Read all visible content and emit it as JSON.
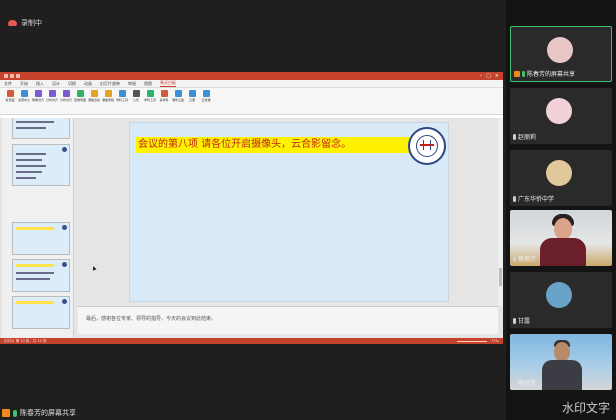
{
  "recording": {
    "label": "录制中"
  },
  "screen_share": {
    "owner_label": "陈春芳的屏幕共享"
  },
  "ppt": {
    "menu": [
      "文件",
      "开始",
      "插入",
      "设计",
      "切换",
      "动画",
      "幻灯片放映",
      "审阅",
      "视图",
      "希沃白板"
    ],
    "ribbon_buttons": [
      "新页面",
      "资源中心",
      "两端对齐",
      "分布对齐",
      "分布对齐",
      "思维导图",
      "课堂活动",
      "课堂测验",
      "学科工具",
      "公式",
      "学科工具",
      "多学科",
      "课件云盘",
      "云课",
      "云授课"
    ],
    "slide_title": "会议的第八项   请各位开启摄像头，云合影留念。",
    "notes": "最后，感谢各位专家、领导的指导，今天的会议到此结束。",
    "status": "幻灯片 第 10 张，共 10 张",
    "zoom": "77%"
  },
  "participants": [
    {
      "name": "陈春芳的屏幕共享",
      "avatar_color": "#e8c6c6",
      "active": true,
      "muted": false
    },
    {
      "name": "赵丽莉",
      "avatar_color": "#f2d2d8",
      "active": false,
      "muted": true
    },
    {
      "name": "广东华侨中学",
      "avatar_color": "#e0c89a",
      "active": false,
      "muted": true
    },
    {
      "name": "蔡佩芬",
      "video": "person1",
      "active": false,
      "muted": true
    },
    {
      "name": "甘露",
      "avatar_color": "#6aa3c8",
      "active": false,
      "muted": true
    },
    {
      "name": "熊妍亮",
      "video": "person2",
      "active": false,
      "muted": true
    }
  ],
  "watermark": "水印文字"
}
